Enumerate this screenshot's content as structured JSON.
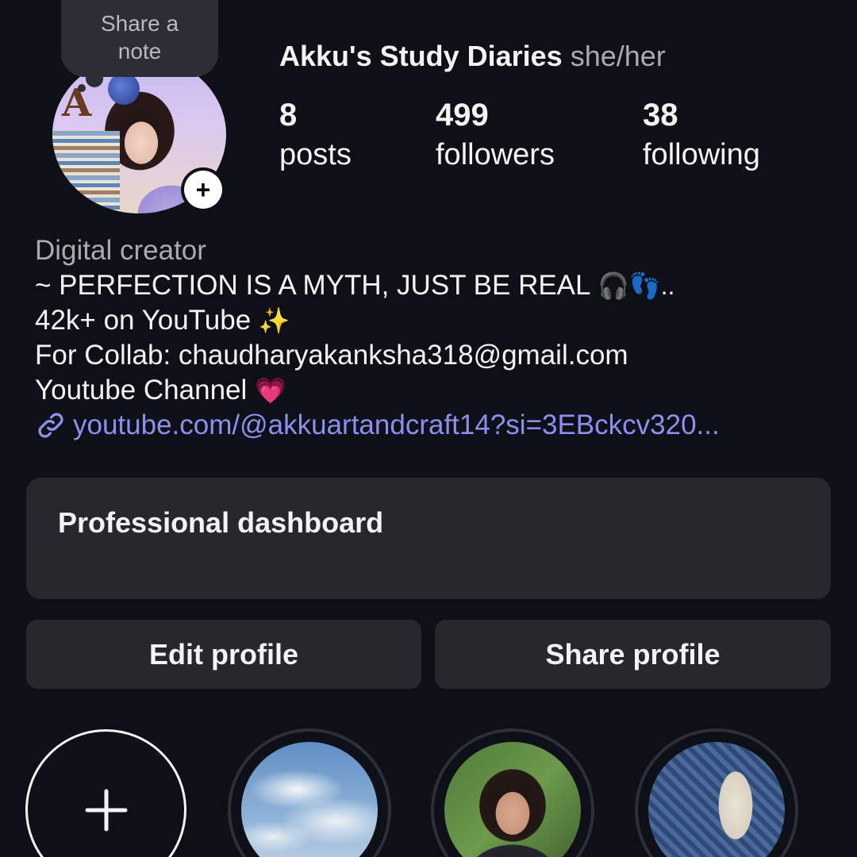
{
  "note": {
    "line1": "Share a",
    "line2": "note"
  },
  "profile": {
    "name": "Akku's Study Diaries",
    "pronouns": "she/her",
    "avatar_icon": "profile-photo",
    "add_story_symbol": "+"
  },
  "stats": [
    {
      "value": "8",
      "label": "posts"
    },
    {
      "value": "499",
      "label": "followers"
    },
    {
      "value": "38",
      "label": "following"
    }
  ],
  "bio": {
    "category": "Digital creator",
    "line1": "~ PERFECTION IS A MYTH, JUST BE REAL",
    "line1_emoji": "🎧👣..",
    "line2": "42k+ on YouTube",
    "line2_emoji": "✨",
    "line3": "For Collab: chaudharyakanksha318@gmail.com",
    "line4": "Youtube Channel",
    "line4_emoji": "💗",
    "link": "youtube.com/@akkuartandcraft14?si=3EBckcv320...",
    "link_color": "#8c8ff0"
  },
  "dashboard": {
    "title": "Professional dashboard"
  },
  "buttons": {
    "edit": "Edit profile",
    "share": "Share profile"
  },
  "highlights": {
    "new_symbol": "+",
    "items": [
      {
        "name": "highlight-sky"
      },
      {
        "name": "highlight-portrait"
      },
      {
        "name": "highlight-craft"
      }
    ]
  },
  "colors": {
    "background": "#0d1016",
    "card": "#26282e",
    "text": "#f4f4f5",
    "muted": "#a8abb0"
  }
}
